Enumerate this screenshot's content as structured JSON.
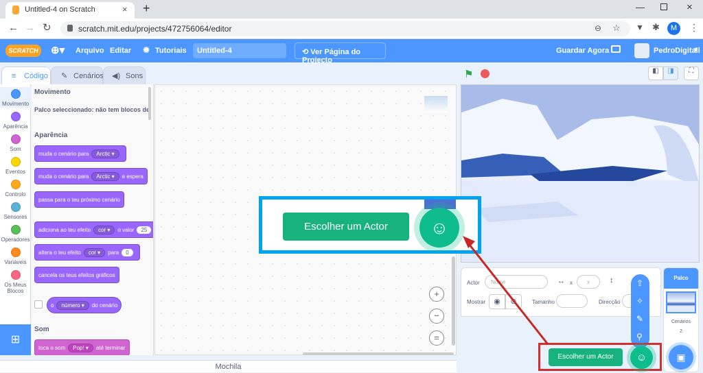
{
  "browser": {
    "tab_title": "Untitled-4 on Scratch",
    "new_tab": "+",
    "url": "scratch.mit.edu/projects/472756064/editor",
    "profile_initial": "M"
  },
  "menu": {
    "logo": "SCRATCH",
    "file": "Arquivo",
    "edit": "Editar",
    "tutorials": "Tutoriais",
    "project_title": "Untitled-4",
    "see_project": "Ver Página do Projecto",
    "save_now": "Guardar Agora",
    "username": "PedroDigitall"
  },
  "editor_tabs": {
    "code": "Código",
    "costumes": "Cenários",
    "sounds": "Sons"
  },
  "categories": [
    {
      "label": "Movimento",
      "color": "#4c97ff"
    },
    {
      "label": "Aparência",
      "color": "#9966ff"
    },
    {
      "label": "Som",
      "color": "#cf63cf"
    },
    {
      "label": "Eventos",
      "color": "#ffd500"
    },
    {
      "label": "Controlo",
      "color": "#ffab19"
    },
    {
      "label": "Sensores",
      "color": "#5cb1d6"
    },
    {
      "label": "Operadores",
      "color": "#59c059"
    },
    {
      "label": "Variáveis",
      "color": "#ff8c1a"
    },
    {
      "label": "Os Meus Blocos",
      "color": "#ff6680"
    }
  ],
  "palette": {
    "motion_heading": "Movimento",
    "motion_note": "Palco seleccionado: não tem blocos de",
    "looks_heading": "Aparência",
    "b1": {
      "text": "muda o cenário para",
      "value": "Arctic"
    },
    "b2": {
      "text": "muda o cenário para",
      "value": "Arctic",
      "suffix": "e espera"
    },
    "b3": {
      "text": "passa para o teu próximo cenário"
    },
    "b4": {
      "text": "adiciona ao teu efeito",
      "value": "cor",
      "mid": "o valor",
      "num": "25"
    },
    "b5": {
      "text": "altera o teu efeito",
      "value": "cor",
      "mid": "para",
      "num": "0"
    },
    "b6": {
      "text": "cancela os teus efeitos gráficos"
    },
    "b7": {
      "value": "número",
      "suffix": "do cenário",
      "prefix": "o"
    },
    "sound_heading": "Som",
    "b8": {
      "text": "toca o som",
      "value": "Pop!",
      "suffix": "até terminar"
    }
  },
  "workspace": {
    "zoom_in": "+",
    "zoom_out": "−",
    "reset": "="
  },
  "bottom": {
    "backpack": "Mochila"
  },
  "sprite_info": {
    "actor_label": "Actor",
    "name_placeholder": "Nome",
    "x_label": "x",
    "x_placeholder": "x",
    "y_label": "y",
    "show_label": "Mostrar",
    "size_label": "Tamanho",
    "direction_label": "Direcção"
  },
  "stage_panel": {
    "title": "Palco",
    "backdrops_label": "Cenários",
    "backdrops_count": "2"
  },
  "tooltip": {
    "label": "Escolher um Actor"
  },
  "colors": {
    "accent": "#4c97ff",
    "looks": "#9966ff",
    "sprite_green": "#0fbd8c",
    "highlight_blue": "#00a3f0",
    "highlight_red": "#d32f2f"
  }
}
